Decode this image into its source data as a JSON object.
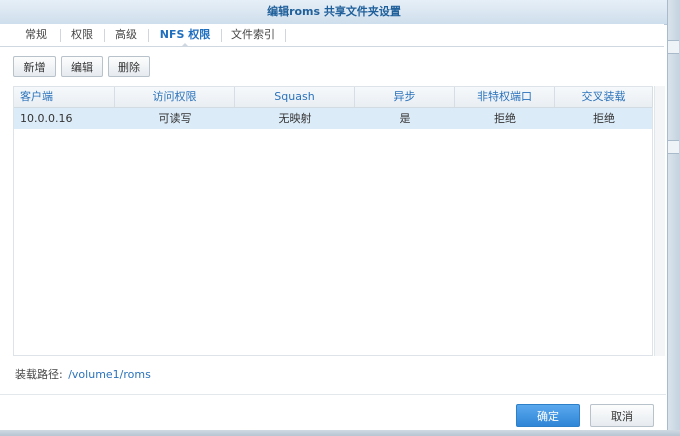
{
  "window": {
    "title": "编辑roms 共享文件夹设置"
  },
  "tabs": [
    {
      "label": "常规"
    },
    {
      "label": "权限"
    },
    {
      "label": "高级"
    },
    {
      "label": "NFS 权限",
      "active": true
    },
    {
      "label": "文件索引"
    }
  ],
  "toolbar": {
    "add_label": "新增",
    "edit_label": "编辑",
    "delete_label": "删除"
  },
  "table": {
    "headers": [
      "客户端",
      "访问权限",
      "Squash",
      "异步",
      "非特权端口",
      "交叉装载"
    ],
    "rows": [
      [
        "10.0.0.16",
        "可读写",
        "无映射",
        "是",
        "拒绝",
        "拒绝"
      ]
    ]
  },
  "mount_path": {
    "label": "装载路径:",
    "value": "/volume1/roms"
  },
  "footer": {
    "ok_label": "确定",
    "cancel_label": "取消"
  },
  "colors": {
    "accent": "#1f6fbf",
    "selected_row": "#dcebf8",
    "primary_button": "#2f86d6"
  }
}
